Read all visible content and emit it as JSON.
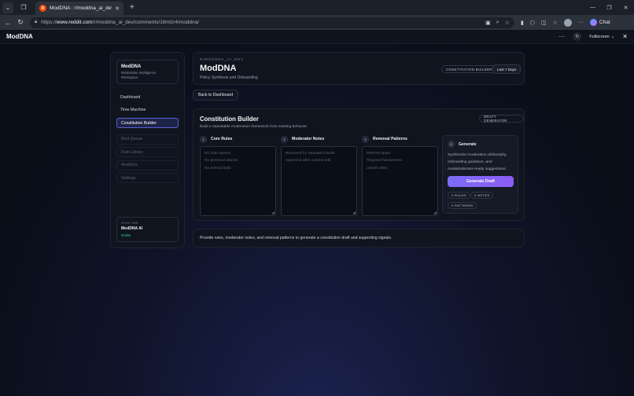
{
  "browser": {
    "tab_title": "ModDNA : r/moddna_ai_dev",
    "favicon_text": "R",
    "url_prefix": "https://",
    "url_host": "www.reddit.com",
    "url_path": "/r/moddna_ai_dev/comments/1ltmlzr4/moddna/",
    "chat_label": "Chat"
  },
  "app": {
    "title": "ModDNA",
    "fullscreen_label": "Fullscreen"
  },
  "sidebar": {
    "brand_name": "ModDNA",
    "brand_subtitle": "Moderation Intelligence Workspace",
    "items": [
      {
        "label": "Dashboard"
      },
      {
        "label": "Time Machine"
      },
      {
        "label": "Constitution Builder"
      },
      {
        "label": "Mod Queue"
      },
      {
        "label": "Rule Library"
      },
      {
        "label": "Analytics"
      },
      {
        "label": "Settings"
      }
    ],
    "runtime_label": "RUNTIME",
    "runtime_name": "ModDNA AI",
    "runtime_status": "Online",
    "status_color": "#34d399",
    "active_color": "#5a5fd6"
  },
  "header": {
    "eyebrow": "R/MODDNA_AI_DEV",
    "title": "ModDNA",
    "subtitle": "Policy Synthesis and Onboarding",
    "builder_pill": "CONSTITUTION BUILDER",
    "range_pill": "Last 7 Days"
  },
  "back_button": "Back to Dashboard",
  "builder": {
    "title": "Constitution Builder",
    "subtitle": "Build a repeatable moderation framework from existing behavior",
    "draft_pill": "DRAFT GENERATOR",
    "columns": [
      {
        "num": "1",
        "label": "Core Rules",
        "lines": [
          "No hate speech",
          "No personal attacks",
          "No referral links"
        ]
      },
      {
        "num": "2",
        "label": "Moderator Notes",
        "lines": [
          "Removed for repeated insults",
          "Approved after context edit"
        ]
      },
      {
        "num": "3",
        "label": "Removal Patterns",
        "lines": [
          "Referral spam",
          "Targeted harassment",
          "Unsafe links"
        ]
      }
    ],
    "generate": {
      "num": "4",
      "label": "Generate",
      "description": "Synthesize moderation philosophy, onboarding guidance, and AutoModerator-ready suggestions.",
      "button": "Generate Draft",
      "accent": "#7c6cf6",
      "stats": [
        "0 RULES",
        "0 NOTES",
        "0 PATTERNS"
      ]
    }
  },
  "info_text": "Provide rules, moderator notes, and removal patterns to generate a constitution draft and supporting signals."
}
